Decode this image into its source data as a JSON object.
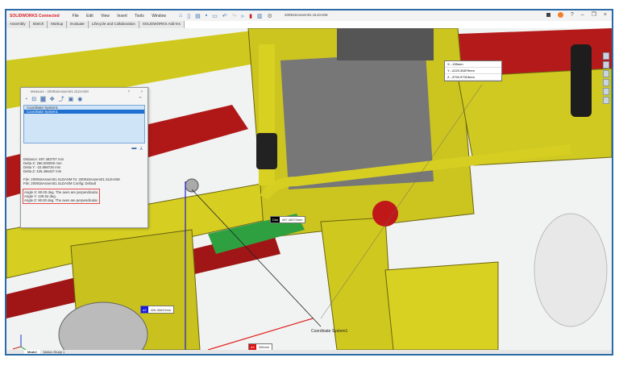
{
  "app": {
    "logo": "SOLIDWORKS Connected",
    "document_title": "200916Assem01.SLDASM"
  },
  "menu": [
    "File",
    "Edit",
    "View",
    "Insert",
    "Tools",
    "Window"
  ],
  "toolbar_icons": [
    "home-icon",
    "new-icon",
    "open-icon",
    "save-icon",
    "print-icon",
    "undo-icon",
    "redo-icon",
    "select-icon",
    "traffic-light-icon",
    "options-icon",
    "settings-icon"
  ],
  "window_controls": {
    "minimize": "–",
    "restore": "❐",
    "close": "×"
  },
  "command_tabs": [
    "Assembly",
    "Sketch",
    "Markup",
    "Evaluate",
    "Lifecycle and Collaboration",
    "SOLIDWORKS Add-Ins"
  ],
  "measure": {
    "title": "Measure - 200916Assem01.SLDASM",
    "help": "?",
    "close": "×",
    "selections": [
      "Coordinate System1",
      "Coordinate System1"
    ],
    "results": [
      "Distance: 497.483707 mm",
      "Delta X: 266.000000 mm",
      "Delta Y: -22.898726 mm",
      "Delta Z: 426.466437 mm",
      "",
      "File: 200916Assem01.SLDASM To: 200916Assem01.SLDASM",
      "File: 200916Assem01.SLDASM Config: Default"
    ],
    "angles": [
      "Angle X: 90.00 deg. The axes are perpendicular.",
      "Angle Y: 129.52 deg.",
      "Angle Z: 90.00 deg. The axes are perpendicular."
    ]
  },
  "callouts": {
    "xyz": [
      "X: -155mm",
      "Y: -2229.30879mm",
      "Z: -3794.97315mm"
    ],
    "dist": {
      "tag": "Dist",
      "value": "497.48370mm",
      "color": "#000000"
    },
    "dz": {
      "tag": "dZ",
      "value": "426.46643mm",
      "color": "#1a1adc"
    },
    "dx": {
      "tag": "dX",
      "value": "266mm",
      "color": "#e01010"
    },
    "coord_label": "Coordinate System1"
  },
  "bottom_tabs": [
    "Model",
    "Motion Study 1"
  ],
  "colors": {
    "frame": "#2b6ca8",
    "part_yellow": "#d8d020",
    "part_red": "#b01818",
    "highlight_box": "#e05050"
  }
}
